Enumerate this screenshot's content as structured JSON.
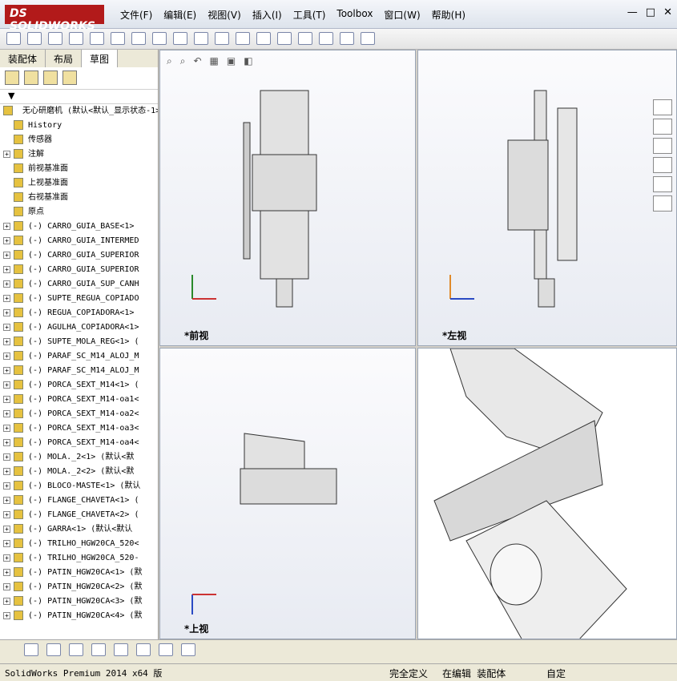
{
  "app": {
    "logo": "DS SOLIDWORKS"
  },
  "menu": [
    "文件(F)",
    "编辑(E)",
    "视图(V)",
    "插入(I)",
    "工具(T)",
    "Toolbox",
    "窗口(W)",
    "帮助(H)"
  ],
  "tabs": [
    "装配体",
    "布局",
    "草图"
  ],
  "tree": {
    "root": "无心研磨机 (默认<默认_显示状态-1>)",
    "items": [
      {
        "label": "History",
        "expandable": false
      },
      {
        "label": "传感器",
        "expandable": false
      },
      {
        "label": "注解",
        "expandable": true
      },
      {
        "label": "前视基准面",
        "expandable": false
      },
      {
        "label": "上视基准面",
        "expandable": false
      },
      {
        "label": "右视基准面",
        "expandable": false
      },
      {
        "label": "原点",
        "expandable": false
      },
      {
        "label": "(-) CARRO_GUIA_BASE<1>",
        "expandable": true
      },
      {
        "label": "(-) CARRO_GUIA_INTERMED",
        "expandable": true
      },
      {
        "label": "(-) CARRO_GUIA_SUPERIOR",
        "expandable": true
      },
      {
        "label": "(-) CARRO_GUIA_SUPERIOR",
        "expandable": true
      },
      {
        "label": "(-) CARRO_GUIA_SUP_CANH",
        "expandable": true
      },
      {
        "label": "(-) SUPTE_REGUA_COPIADO",
        "expandable": true
      },
      {
        "label": "(-) REGUA_COPIADORA<1>",
        "expandable": true
      },
      {
        "label": "(-) AGULHA_COPIADORA<1>",
        "expandable": true
      },
      {
        "label": "(-) SUPTE_MOLA_REG<1> (",
        "expandable": true
      },
      {
        "label": "(-) PARAF_SC_M14_ALOJ_M",
        "expandable": true
      },
      {
        "label": "(-) PARAF_SC_M14_ALOJ_M",
        "expandable": true
      },
      {
        "label": "(-) PORCA_SEXT_M14<1> (",
        "expandable": true
      },
      {
        "label": "(-) PORCA_SEXT_M14-oa1<",
        "expandable": true
      },
      {
        "label": "(-) PORCA_SEXT_M14-oa2<",
        "expandable": true
      },
      {
        "label": "(-) PORCA_SEXT_M14-oa3<",
        "expandable": true
      },
      {
        "label": "(-) PORCA_SEXT_M14-oa4<",
        "expandable": true
      },
      {
        "label": "(-) MOLA._2<1> (默认<默",
        "expandable": true
      },
      {
        "label": "(-) MOLA._2<2> (默认<默",
        "expandable": true
      },
      {
        "label": "(-) BLOCO-MASTE<1> (默认",
        "expandable": true
      },
      {
        "label": "(-) FLANGE_CHAVETA<1> (",
        "expandable": true
      },
      {
        "label": "(-) FLANGE_CHAVETA<2> (",
        "expandable": true
      },
      {
        "label": "(-) GARRA<1> (默认<默认",
        "expandable": true
      },
      {
        "label": "(-) TRILHO_HGW20CA_520<",
        "expandable": true
      },
      {
        "label": "(-) TRILHO_HGW20CA_520-",
        "expandable": true
      },
      {
        "label": "(-) PATIN_HGW20CA<1> (默",
        "expandable": true
      },
      {
        "label": "(-) PATIN_HGW20CA<2> (默",
        "expandable": true
      },
      {
        "label": "(-) PATIN_HGW20CA<3> (默",
        "expandable": true
      },
      {
        "label": "(-) PATIN_HGW20CA<4> (默",
        "expandable": true
      }
    ]
  },
  "viewports": {
    "front": {
      "label": "*前视",
      "axes": [
        "X",
        "Y"
      ]
    },
    "left": {
      "label": "*左视",
      "axes": [
        "Z",
        "Y"
      ]
    },
    "top": {
      "label": "*上视",
      "axes": [
        "X",
        "Z"
      ]
    },
    "iso": {
      "label": ""
    }
  },
  "status": {
    "left": "SolidWorks Premium 2014 x64 版",
    "defined": "完全定义",
    "editing": "在编辑 装配体",
    "custom": "自定"
  }
}
